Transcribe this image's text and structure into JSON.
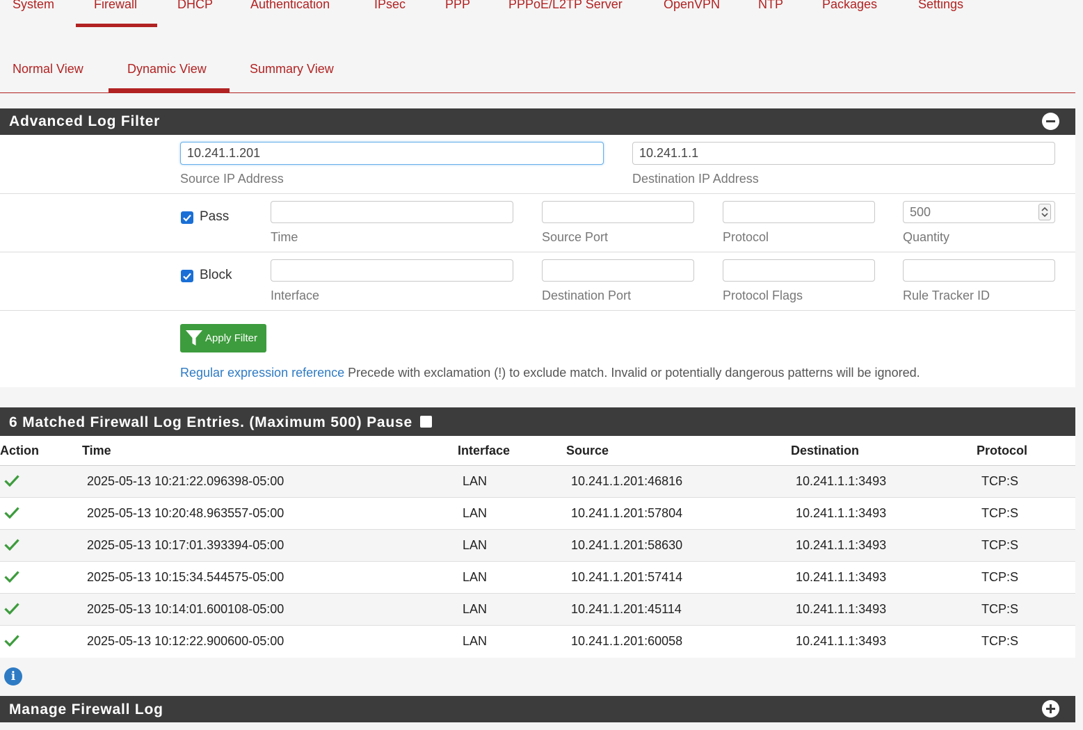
{
  "top_tabs": [
    {
      "label": "System"
    },
    {
      "label": "Firewall",
      "active": true
    },
    {
      "label": "DHCP"
    },
    {
      "label": "Authentication"
    },
    {
      "label": "IPsec"
    },
    {
      "label": "PPP"
    },
    {
      "label": "PPPoE/L2TP Server"
    },
    {
      "label": "OpenVPN"
    },
    {
      "label": "NTP"
    },
    {
      "label": "Packages"
    },
    {
      "label": "Settings"
    }
  ],
  "sub_tabs": [
    {
      "label": "Normal View"
    },
    {
      "label": "Dynamic View",
      "active": true
    },
    {
      "label": "Summary View"
    }
  ],
  "filter": {
    "title": "Advanced Log Filter",
    "source_ip": {
      "value": "10.241.1.201",
      "label": "Source IP Address"
    },
    "dest_ip": {
      "value": "10.241.1.1",
      "label": "Destination IP Address"
    },
    "pass": {
      "label": "Pass",
      "checked": true
    },
    "block": {
      "label": "Block",
      "checked": true
    },
    "time": {
      "value": "",
      "label": "Time"
    },
    "source_port": {
      "value": "",
      "label": "Source Port"
    },
    "protocol": {
      "value": "",
      "label": "Protocol"
    },
    "quantity": {
      "value": "",
      "placeholder": "500",
      "label": "Quantity"
    },
    "interface": {
      "value": "",
      "label": "Interface"
    },
    "dest_port": {
      "value": "",
      "label": "Destination Port"
    },
    "protocol_flags": {
      "value": "",
      "label": "Protocol Flags"
    },
    "rule_tracker": {
      "value": "",
      "label": "Rule Tracker ID"
    },
    "apply_label": "Apply Filter",
    "regex_link": "Regular expression reference",
    "regex_note": "Precede with exclamation (!) to exclude match. Invalid or potentially dangerous patterns will be ignored."
  },
  "log": {
    "title": "6 Matched Firewall Log Entries. (Maximum 500) Pause",
    "columns": [
      "Action",
      "Time",
      "Interface",
      "Source",
      "Destination",
      "Protocol"
    ],
    "rows": [
      {
        "action": "pass",
        "time": "2025-05-13 10:21:22.096398-05:00",
        "interface": "LAN",
        "source": "10.241.1.201:46816",
        "destination": "10.241.1.1:3493",
        "protocol": "TCP:S"
      },
      {
        "action": "pass",
        "time": "2025-05-13 10:20:48.963557-05:00",
        "interface": "LAN",
        "source": "10.241.1.201:57804",
        "destination": "10.241.1.1:3493",
        "protocol": "TCP:S"
      },
      {
        "action": "pass",
        "time": "2025-05-13 10:17:01.393394-05:00",
        "interface": "LAN",
        "source": "10.241.1.201:58630",
        "destination": "10.241.1.1:3493",
        "protocol": "TCP:S"
      },
      {
        "action": "pass",
        "time": "2025-05-13 10:15:34.544575-05:00",
        "interface": "LAN",
        "source": "10.241.1.201:57414",
        "destination": "10.241.1.1:3493",
        "protocol": "TCP:S"
      },
      {
        "action": "pass",
        "time": "2025-05-13 10:14:01.600108-05:00",
        "interface": "LAN",
        "source": "10.241.1.201:45114",
        "destination": "10.241.1.1:3493",
        "protocol": "TCP:S"
      },
      {
        "action": "pass",
        "time": "2025-05-13 10:12:22.900600-05:00",
        "interface": "LAN",
        "source": "10.241.1.201:60058",
        "destination": "10.241.1.1:3493",
        "protocol": "TCP:S"
      }
    ]
  },
  "manage": {
    "title": "Manage Firewall Log"
  },
  "colors": {
    "accent": "#b22222",
    "panel_header": "#3c3c3c",
    "pass_icon": "#3d9c3d",
    "apply_button": "#3d9c3d",
    "link": "#2e7bc4"
  },
  "icons": {
    "collapse": "minus-circle-icon",
    "expand": "plus-circle-icon",
    "info": "info-icon",
    "filter": "funnel-icon",
    "pass": "check-icon"
  }
}
